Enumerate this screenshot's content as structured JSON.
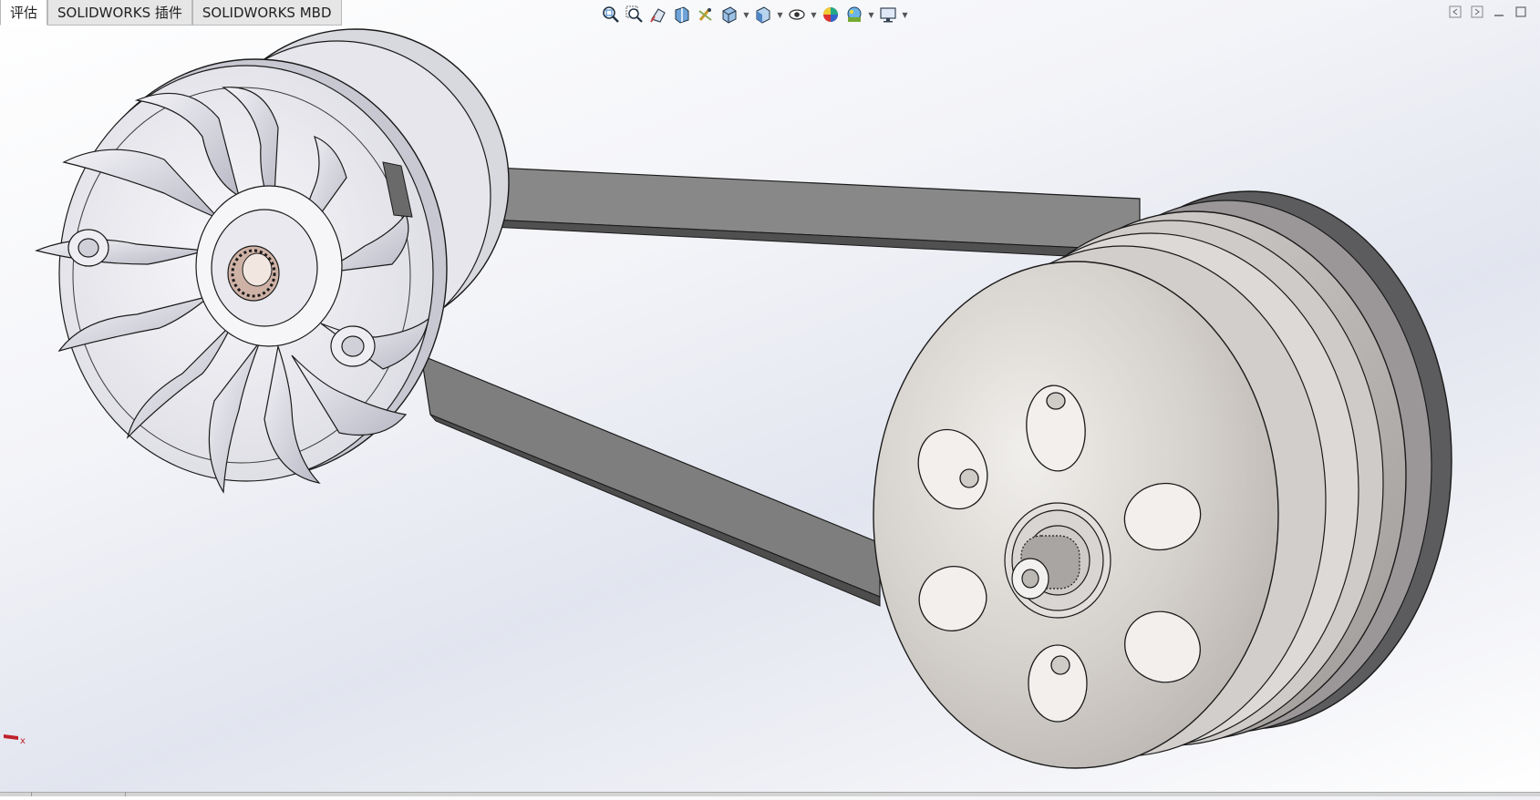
{
  "tabs": [
    {
      "label": "评估",
      "active": true
    },
    {
      "label": "SOLIDWORKS 插件",
      "active": false
    },
    {
      "label": "SOLIDWORKS MBD",
      "active": false
    }
  ],
  "heads_up_toolbar": [
    {
      "icon": "zoom-to-fit-icon"
    },
    {
      "icon": "zoom-to-area-icon"
    },
    {
      "icon": "previous-view-icon"
    },
    {
      "icon": "section-view-icon"
    },
    {
      "icon": "dynamic-annotation-views-icon"
    },
    {
      "icon": "view-orientation-icon",
      "dropdown": true
    },
    {
      "icon": "display-style-icon",
      "dropdown": true
    },
    {
      "icon": "hide-show-items-icon",
      "dropdown": true
    },
    {
      "icon": "edit-appearance-icon"
    },
    {
      "icon": "apply-scene-icon",
      "dropdown": true
    },
    {
      "icon": "view-settings-icon",
      "dropdown": true
    }
  ],
  "triad": {
    "axis_label": "x"
  },
  "colors": {
    "background_top": "#ffffff",
    "background_mid": "#e2e5ef",
    "part_light": "#e9e9ee",
    "part_mid": "#c9c9d0",
    "belt_dark": "#5e5e5e",
    "belt_light": "#8a8a8a",
    "edge": "#1a1a1a"
  }
}
